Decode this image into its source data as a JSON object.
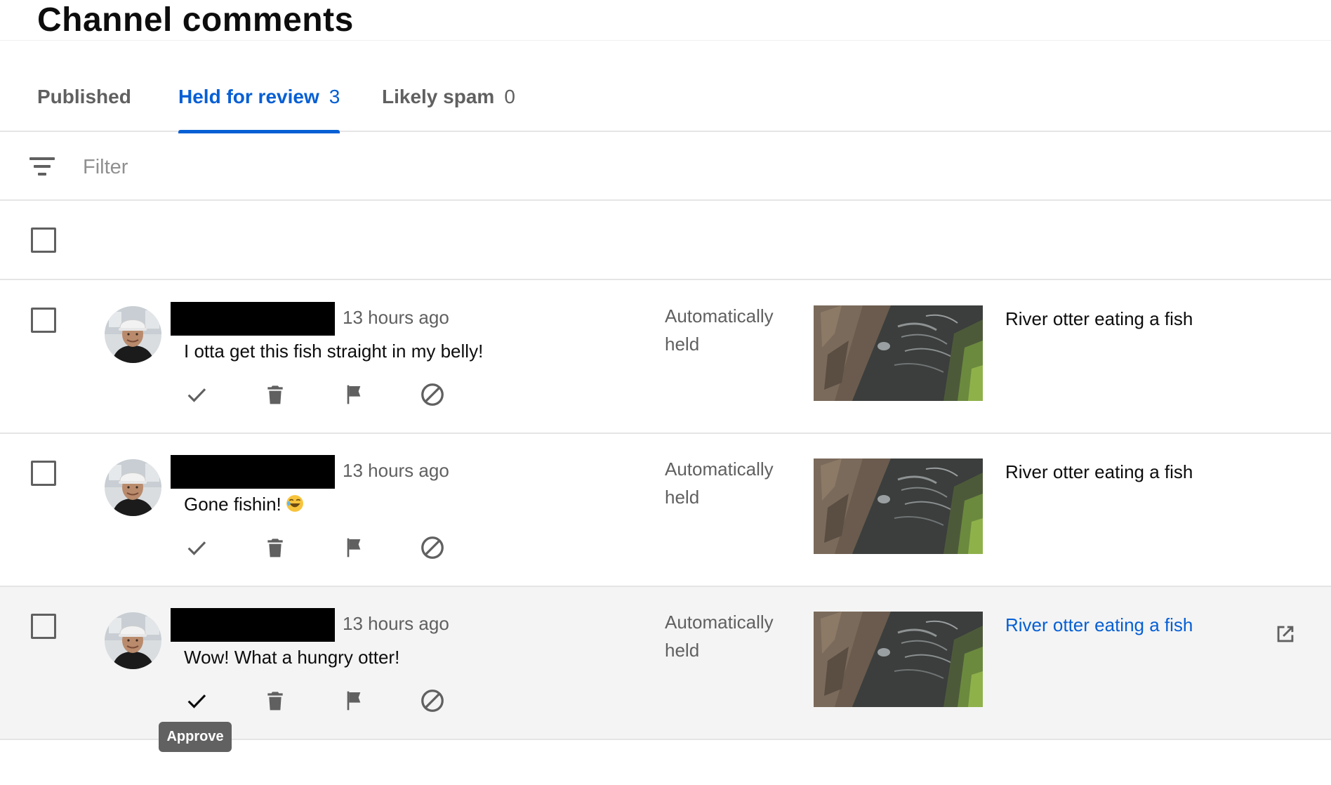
{
  "page": {
    "title": "Channel comments"
  },
  "tabs": [
    {
      "label": "Published",
      "count": ""
    },
    {
      "label": "Held for review",
      "count": "3"
    },
    {
      "label": "Likely spam",
      "count": "0"
    }
  ],
  "active_tab": "Held for review",
  "filter": {
    "placeholder": "Filter",
    "icon": "filter-icon"
  },
  "colors": {
    "accent": "#065fd4",
    "text_secondary": "#606060",
    "hover_row": "#f4f4f4",
    "tooltip_bg": "#616161"
  },
  "comments": [
    {
      "time": "13 hours ago",
      "text": "I otta get this fish straight in my belly!",
      "emoji": "",
      "reason": "Automatically held",
      "video_title": "River otter eating a fish"
    },
    {
      "time": "13 hours ago",
      "text": "Gone fishin!",
      "emoji": "rolling-on-floor-laughing-emoji",
      "reason": "Automatically held",
      "video_title": "River otter eating a fish"
    },
    {
      "time": "13 hours ago",
      "text": "Wow! What a hungry otter!",
      "emoji": "",
      "reason": "Automatically held",
      "video_title": "River otter eating a fish"
    }
  ],
  "actions": [
    "check-icon",
    "trash-icon",
    "flag-icon",
    "block-icon"
  ],
  "tooltip": {
    "text": "Approve"
  }
}
